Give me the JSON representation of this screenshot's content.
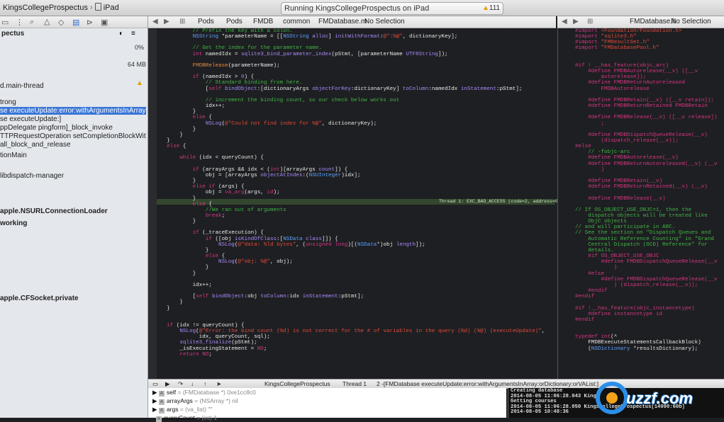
{
  "toolbar": {
    "scheme": "KingsCollegeProspectus",
    "device": "iPad",
    "activity": "Running KingsCollegeProspectus on iPad",
    "warnings": "111"
  },
  "navigator": {
    "title": "pectus",
    "cpu": "0%",
    "memory": "64 MB",
    "rows": [
      "d.main-thread",
      "trong",
      "se executeUpdate:error:withArgumentsInArray:orDictio...",
      "se executeUpdate:]",
      "ppDelegate pingform]_block_invoke",
      "TTPRequestOperation setCompletionBlockWithSuccess:fa...",
      "all_block_and_release",
      "tionMain",
      "libdispatch-manager",
      "apple.NSURLConnectionLoader",
      "working",
      "apple.CFSocket.private"
    ]
  },
  "jumpbar": [
    "Pods",
    "Pods",
    "FMDB",
    "common",
    "FMDatabase.m",
    "No Selection"
  ],
  "jumpbar_right": [
    "FMDatabase.h",
    "No Selection"
  ],
  "editor": {
    "thread_message": "Thread 1: EXC_BAD_ACCESS (code=2, address=0x1)"
  },
  "debug": {
    "items": [
      "KingsCollegeProspectus",
      "Thread 1",
      "2 -[FMDatabase executeUpdate:error:withArgumentsInArray:orDictionary:orVAList:]"
    ]
  },
  "variables": [
    {
      "name": "self",
      "value": "= (FMDatabase *) 0xe1cc8c0"
    },
    {
      "name": "arrayArgs",
      "value": "= (NSArray *) nil"
    },
    {
      "name": "args",
      "value": "= (va_list) \"\""
    },
    {
      "name": "queryCount",
      "value": "= (int) 1"
    }
  ],
  "console": [
    "Creating database",
    "2014-08-05 11:06:28.043 Kings",
    "Getting courses",
    "2014-08-05 11:06:28.050 KingsCollegeProspectus[14090:60b]",
    "2014-08-05 10:48:36"
  ],
  "watermark": "uzzf.com",
  "colors": {
    "accent": "#3875d7",
    "editor_bg": "#1e1f22"
  }
}
